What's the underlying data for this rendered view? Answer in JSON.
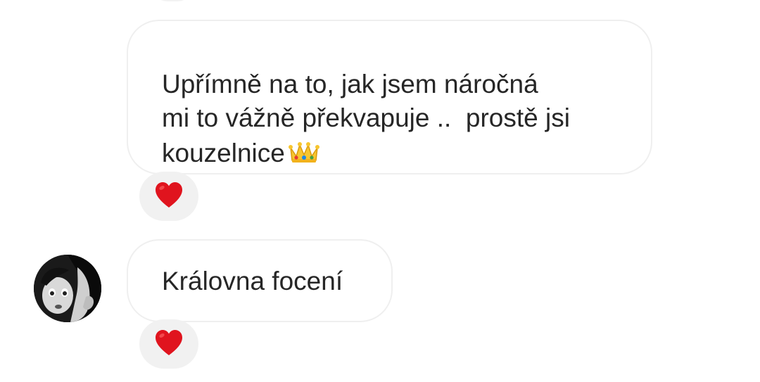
{
  "messages": [
    {
      "sender": "self",
      "lines": [
        "Upřímně na to, jak jsem náročná",
        "mi to vážně překvapuje ..  prostě jsi",
        "kouzelnice"
      ],
      "emoji": "crown-emoji",
      "reaction": "red-heart"
    },
    {
      "sender": "other",
      "lines": [
        "Královna focení"
      ],
      "reaction": "red-heart"
    }
  ],
  "colors": {
    "text": "#262626",
    "bubble_border": "#efefef",
    "reaction_bg": "#f1f1f1",
    "heart": "#e0141e"
  },
  "icons": [
    "crown-emoji",
    "heart-icon",
    "contact-avatar"
  ]
}
